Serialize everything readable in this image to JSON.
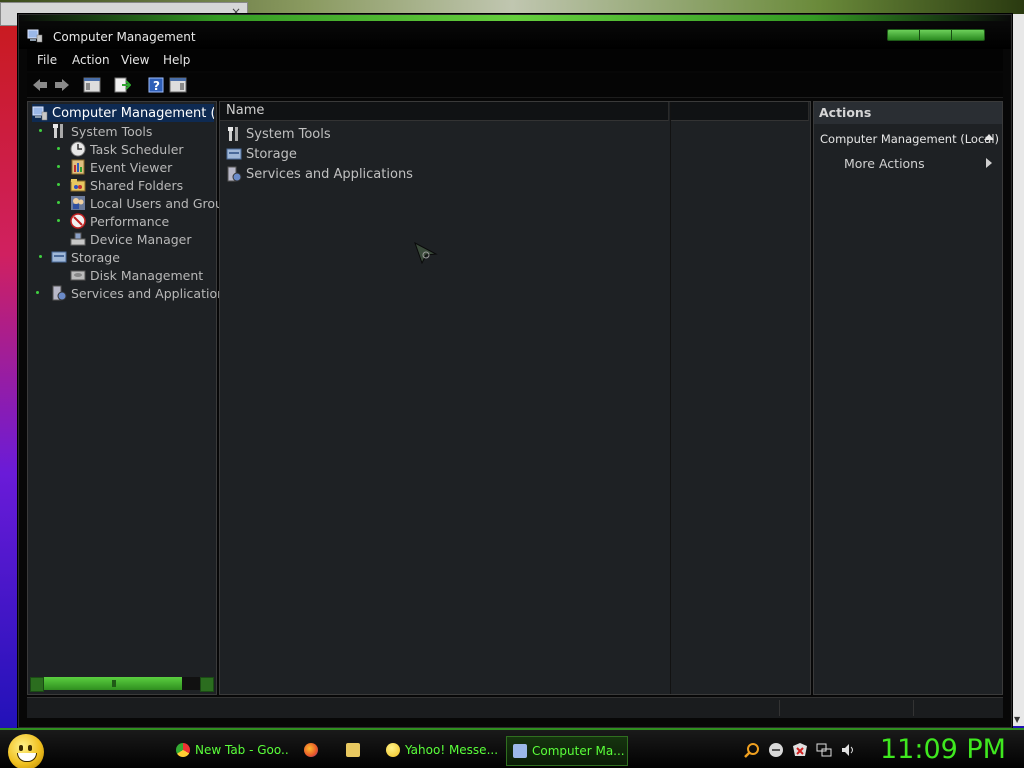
{
  "window": {
    "title": "Computer Management"
  },
  "menu": {
    "file": "File",
    "action": "Action",
    "view": "View",
    "help": "Help"
  },
  "tree": {
    "root": "Computer Management (Loc",
    "system_tools": "System Tools",
    "task_scheduler": "Task Scheduler",
    "event_viewer": "Event Viewer",
    "shared_folders": "Shared Folders",
    "local_users": "Local Users and Grou",
    "performance": "Performance",
    "device_manager": "Device Manager",
    "storage": "Storage",
    "disk_management": "Disk Management",
    "services": "Services and Applications"
  },
  "list": {
    "column_name": "Name",
    "items": [
      "System Tools",
      "Storage",
      "Services and Applications"
    ]
  },
  "actions": {
    "header": "Actions",
    "context": "Computer Management (Local)",
    "more": "More Actions"
  },
  "taskbar": {
    "items": [
      "New Tab - Goo...",
      "Yahoo! Messe...",
      "Computer Ma..."
    ],
    "clock": "11:09 PM"
  }
}
